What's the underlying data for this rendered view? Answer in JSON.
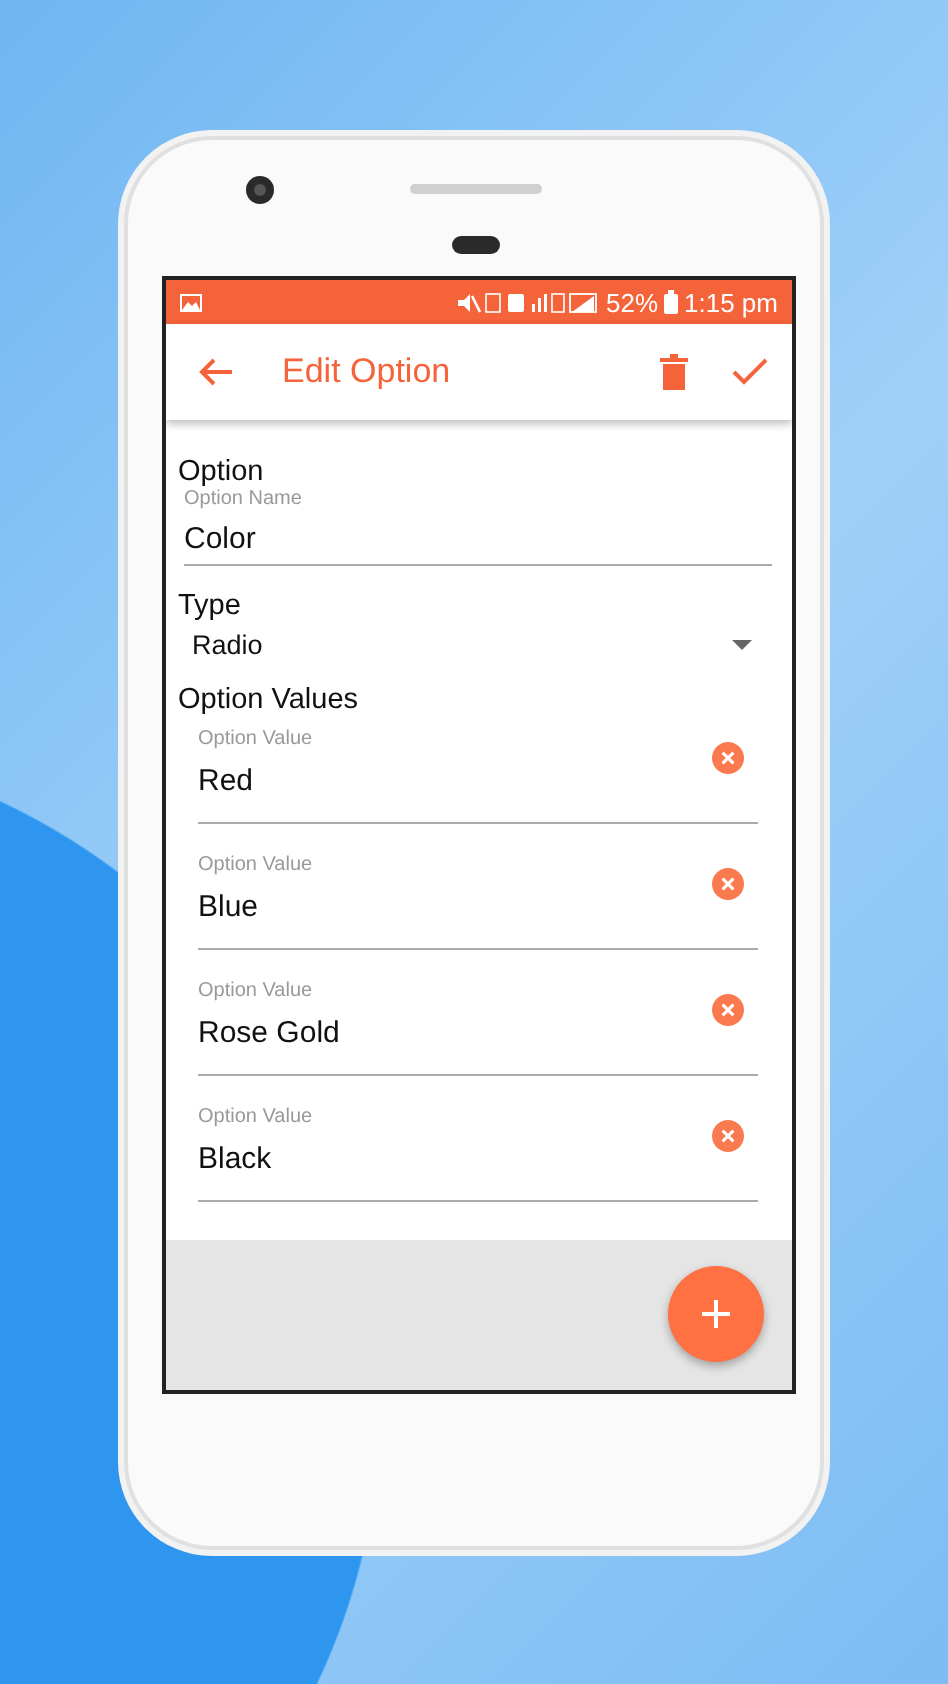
{
  "status_bar": {
    "battery": "52%",
    "time": "1:15 pm"
  },
  "app_bar": {
    "title": "Edit Option"
  },
  "option": {
    "heading": "Option",
    "name_label": "Option Name",
    "name_value": "Color"
  },
  "type": {
    "heading": "Type",
    "value": "Radio"
  },
  "values_heading": "Option Values",
  "option_values": [
    {
      "label": "Option Value",
      "value": "Red"
    },
    {
      "label": "Option Value",
      "value": "Blue"
    },
    {
      "label": "Option Value",
      "value": "Rose Gold"
    },
    {
      "label": "Option Value",
      "value": "Black"
    }
  ]
}
